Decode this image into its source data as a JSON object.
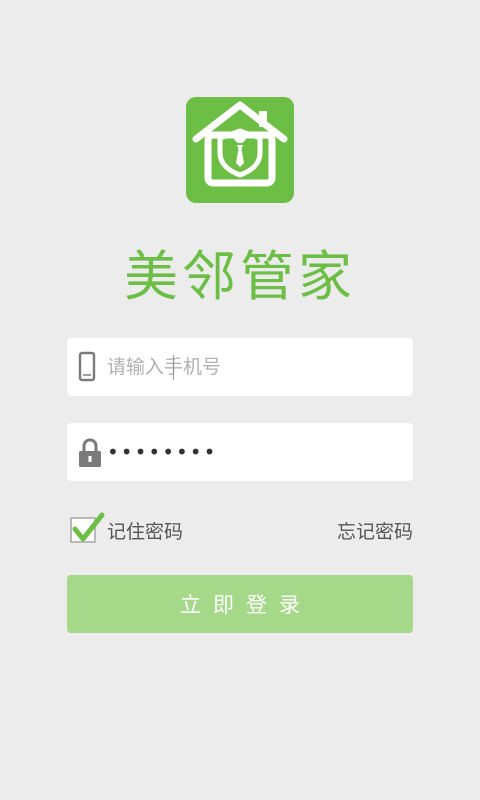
{
  "app": {
    "name": "美邻管家",
    "brand_color": "#6cbe45",
    "logo_icon": "house-shield-icon"
  },
  "phone_field": {
    "icon": "phone-icon",
    "placeholder": "请输入手机号",
    "value": ""
  },
  "password_field": {
    "icon": "lock-icon",
    "value": "••••••••"
  },
  "remember": {
    "label": "记住密码",
    "checked": true,
    "icon": "checkmark-icon"
  },
  "forgot_label": "忘记密码",
  "login_button": {
    "label": "立即登录",
    "color": "#a6d88a"
  }
}
